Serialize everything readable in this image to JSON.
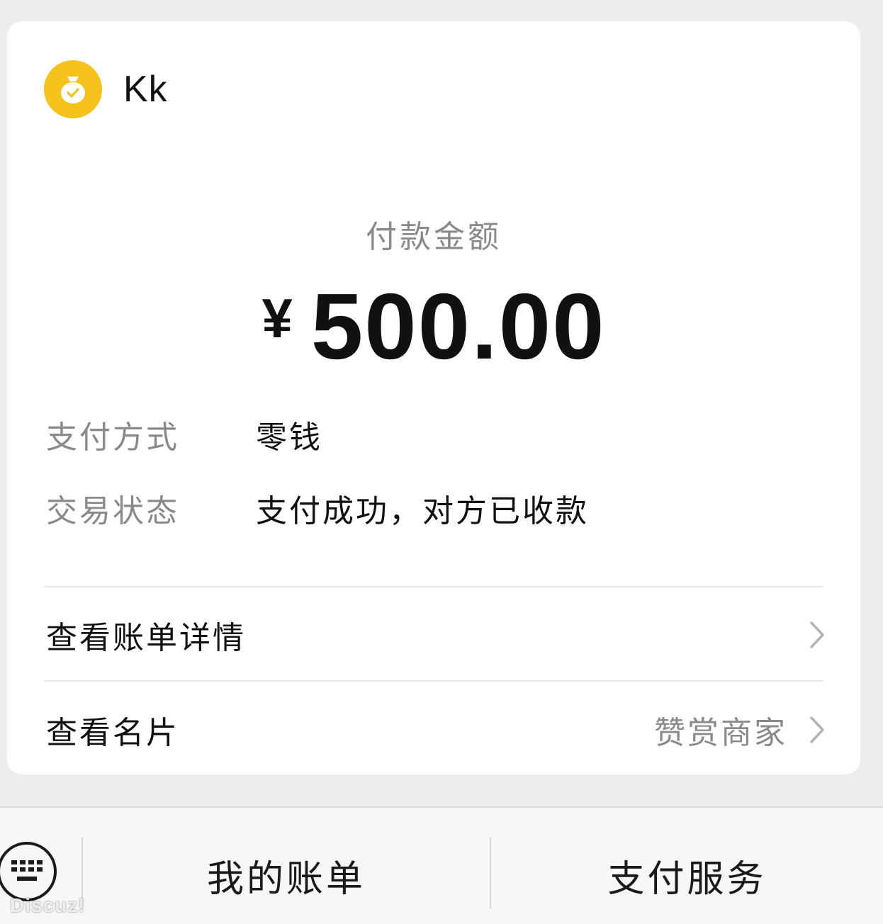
{
  "merchant": {
    "name": "Kk",
    "logo_icon": "money-bag-icon",
    "logo_color": "#f4c21a"
  },
  "payment": {
    "amount_label": "付款金额",
    "currency": "¥",
    "amount": "500.00",
    "method_label": "支付方式",
    "method_value": "零钱",
    "status_label": "交易状态",
    "status_value": "支付成功，对方已收款"
  },
  "links": {
    "bill_details": "查看账单详情",
    "view_card": "查看名片",
    "reward_merchant": "赞赏商家"
  },
  "bottom_bar": {
    "keyboard_icon": "keyboard-icon",
    "my_bills": "我的账单",
    "pay_service": "支付服务"
  },
  "watermark": "Discuz!"
}
